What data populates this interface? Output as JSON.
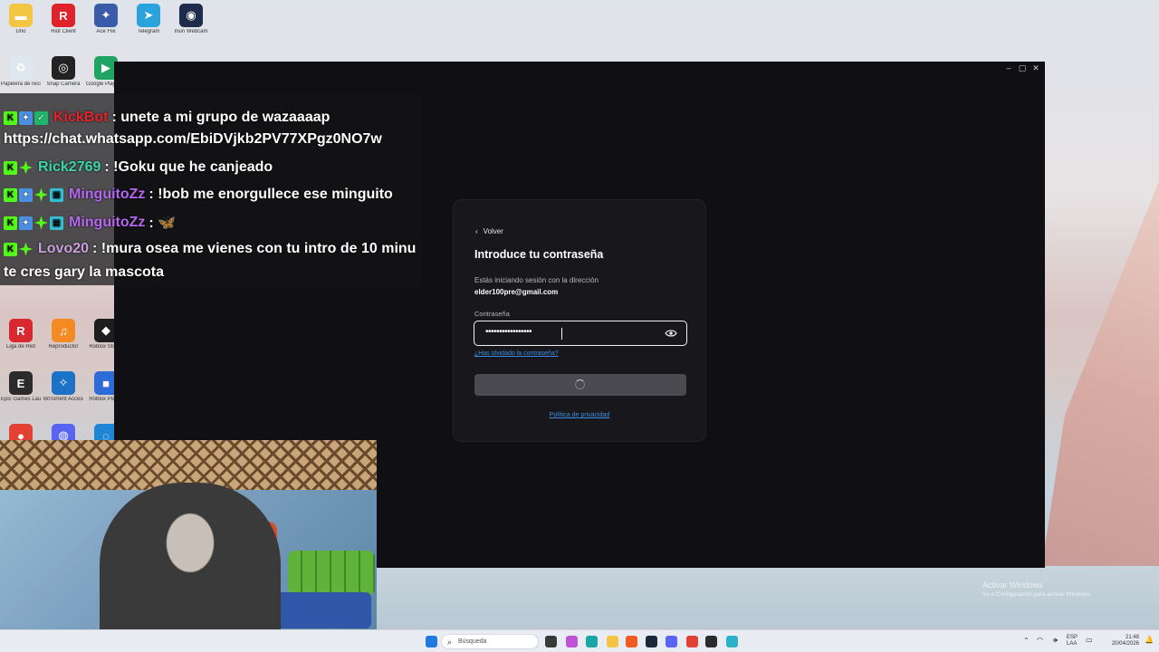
{
  "desktop": {
    "icons": [
      {
        "label": "Uno",
        "color": "#f4c542",
        "glyph": "▬"
      },
      {
        "label": "Riot Client",
        "color": "#e0232b",
        "glyph": "R"
      },
      {
        "label": "Ace Flix",
        "color": "#3a5ba8",
        "glyph": "✦"
      },
      {
        "label": "Telegram",
        "color": "#2aa3dd",
        "glyph": "➤"
      },
      {
        "label": "Iriun Webcam",
        "color": "#1e2b4b",
        "glyph": "◉"
      },
      {
        "label": "Papelera de reciclaje",
        "color": "#dfe7ef",
        "glyph": "♻"
      },
      {
        "label": "Snap Camera",
        "color": "#222222",
        "glyph": "◎"
      },
      {
        "label": "Google Play Juegos",
        "color": "#20a464",
        "glyph": "▶"
      },
      {
        "label": "Liga de Riot",
        "color": "#d9282f",
        "glyph": "R"
      },
      {
        "label": "Reproductor",
        "color": "#f48a23",
        "glyph": "♫"
      },
      {
        "label": "Roblox Studio",
        "color": "#1d1d1d",
        "glyph": "◆"
      },
      {
        "label": "Epic Games Launcher",
        "color": "#2b2b2b",
        "glyph": "E"
      },
      {
        "label": "BitTorrent Acceso directo",
        "color": "#1b72c6",
        "glyph": "✧"
      },
      {
        "label": "Roblox Player",
        "color": "#2d6bd6",
        "glyph": "■"
      },
      {
        "label": "",
        "color": "#e34133",
        "glyph": "●"
      },
      {
        "label": "",
        "color": "#5865f2",
        "glyph": "◍"
      },
      {
        "label": "",
        "color": "#1f86d6",
        "glyph": "◌"
      }
    ]
  },
  "window": {
    "minimize": "–",
    "maximize": "▢",
    "close": "✕"
  },
  "login": {
    "back_label": "Volver",
    "title": "Introduce tu contraseña",
    "hint": "Estás iniciando sesión con la dirección",
    "email": "elder100pre@gmail.com",
    "password_label": "Contraseña",
    "password_masked": "•••••••••••••••••",
    "forgot_link": "¿Has olvidado la contraseña?",
    "privacy_link": "Política de privacidad"
  },
  "chat": {
    "messages": [
      {
        "user": "KickBot",
        "user_color": "#e8232b",
        "badges": [
          "k",
          "b",
          "c"
        ],
        "text": ": unete a mi grupo de wazaaaap",
        "text2": "https://chat.whatsapp.com/EbiDVjkb2PV77XPgz0NO7w"
      },
      {
        "user": "Rick2769",
        "user_color": "#3bd6a8",
        "badges": [
          "k",
          "g"
        ],
        "text": ": !Goku que he canjeado",
        "text2": ""
      },
      {
        "user": "MinguitoZz",
        "user_color": "#b667f1",
        "badges": [
          "k",
          "b",
          "g",
          "t"
        ],
        "text": ": !bob me enorgullece ese minguito",
        "text2": ""
      },
      {
        "user": "MinguitoZz",
        "user_color": "#b667f1",
        "badges": [
          "k",
          "b",
          "g",
          "t"
        ],
        "text": ": 🦋",
        "text2": ""
      },
      {
        "user": "Lovo20",
        "user_color": "#c9a0dc",
        "badges": [
          "k",
          "g"
        ],
        "text": ": !mura osea me vienes con tu intro de 10 minu",
        "text2": "te cres gary la mascota"
      }
    ]
  },
  "taskbar": {
    "search_placeholder": "Búsqueda",
    "lang_top": "ESP",
    "lang_bottom": "LAA",
    "time": "21:48",
    "date": "20/04/2026",
    "apps": [
      {
        "name": "start-icon",
        "color": "#1f7ae0"
      },
      {
        "name": "wallpaper-thumbnail",
        "color": "#8a86a8"
      },
      {
        "name": "task-view-icon",
        "color": "#3a3a3a"
      },
      {
        "name": "copilot-icon",
        "color": "#c052d8"
      },
      {
        "name": "edge-icon",
        "color": "#1aa6a6"
      },
      {
        "name": "file-explorer-icon",
        "color": "#f4c542"
      },
      {
        "name": "brave-icon",
        "color": "#f25a22"
      },
      {
        "name": "steam-icon",
        "color": "#1b2838"
      },
      {
        "name": "discord-icon",
        "color": "#5865f2"
      },
      {
        "name": "chrome-icon",
        "color": "#e34133"
      },
      {
        "name": "epic-games-icon",
        "color": "#2b2b2b"
      },
      {
        "name": "calculator-icon",
        "color": "#2ab2c8"
      }
    ]
  },
  "watermark": {
    "line1": "Activar Windows",
    "line2": "Ve a Configuración para activar Windows."
  }
}
